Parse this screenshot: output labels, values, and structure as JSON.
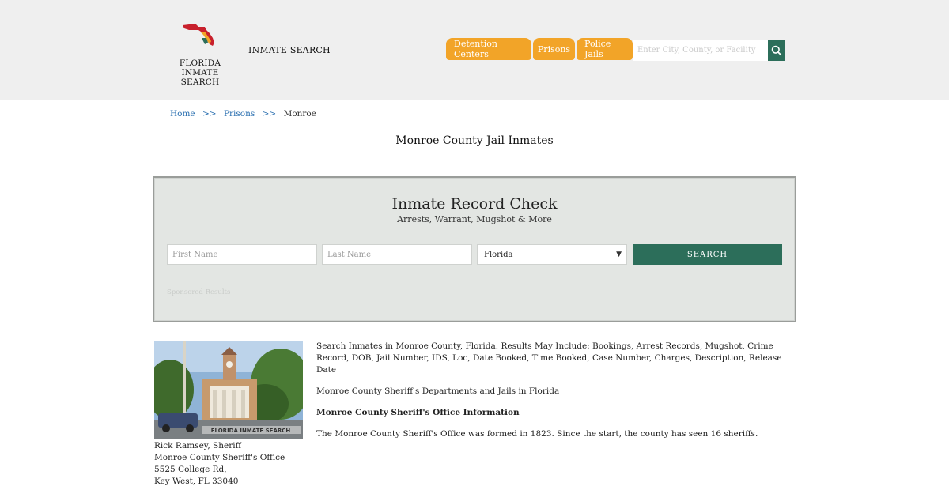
{
  "header": {
    "logo_line1": "FLORIDA",
    "logo_line2": "INMATE SEARCH",
    "site_title": "INMATE SEARCH",
    "nav": [
      "Detention Centers",
      "Prisons",
      "Police Jails"
    ],
    "search_placeholder": "Enter City, County, or Facility",
    "accent_color": "#f2a428",
    "button_color": "#2c6e5a"
  },
  "breadcrumb": {
    "home": "Home",
    "sep": ">>",
    "prisons": "Prisons",
    "current": "Monroe"
  },
  "page_title": "Monroe County Jail Inmates",
  "record_check": {
    "title": "Inmate Record Check",
    "subtitle": "Arrests, Warrant, Mugshot & More",
    "first_name_placeholder": "First Name",
    "last_name_placeholder": "Last Name",
    "state_selected": "Florida",
    "search_label": "SEARCH",
    "sponsored": "Sponsored Results"
  },
  "photo": {
    "icon": "courthouse-photo",
    "watermark": "FLORIDA INMATE SEARCH"
  },
  "contact": {
    "sheriff": "Rick Ramsey, Sheriff",
    "office": "Monroe County Sheriff's Office",
    "street": "5525 College Rd,",
    "city": "Key West, FL 33040"
  },
  "content": {
    "intro": "Search Inmates in Monroe County, Florida. Results May Include: Bookings, Arrest Records, Mugshot, Crime Record, DOB, Jail Number, IDS, Loc, Date Booked, Time Booked, Case Number, Charges, Description, Release Date",
    "departments": "Monroe County Sheriff's Departments and Jails in Florida",
    "info_heading": "Monroe County Sheriff's Office Information",
    "history": "The Monroe County Sheriff's Office was formed in 1823. Since the start, the county has seen 16 sheriffs."
  }
}
